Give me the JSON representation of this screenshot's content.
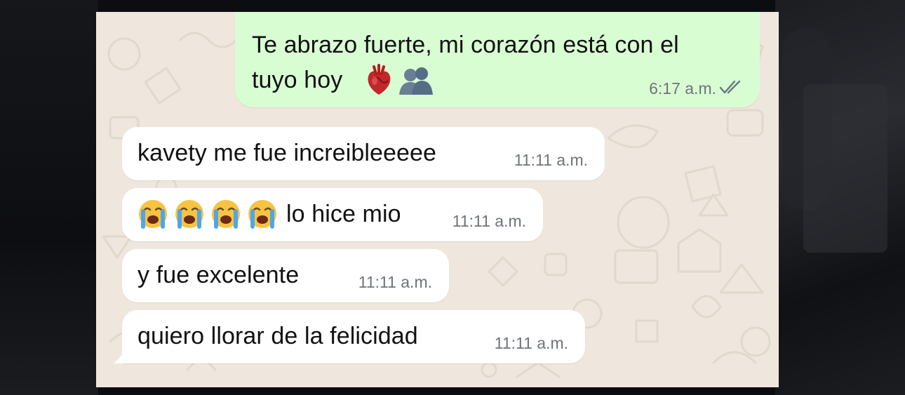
{
  "chat": {
    "colors": {
      "wallpaper": "#efe7dd",
      "outgoing_bubble": "#d9fdd3",
      "incoming_bubble": "#ffffff",
      "timestamp": "#6f7479"
    },
    "outgoing": {
      "line1": "Te abrazo fuerte, mi corazón está con el",
      "line2": "tuyo hoy",
      "emojis": [
        "anatomical-heart-icon",
        "people-silhouette-icon"
      ],
      "time": "6:17 a.m.",
      "status": "read-double-check-icon"
    },
    "incoming": [
      {
        "text": "kavety me fue increibleeeee",
        "time": "11:11 a.m."
      },
      {
        "text": "lo hice mio",
        "emojis": [
          "loudly-crying-face-icon",
          "loudly-crying-face-icon",
          "loudly-crying-face-icon",
          "loudly-crying-face-icon"
        ],
        "time": "11:11 a.m."
      },
      {
        "text": "y fue excelente",
        "time": "11:11 a.m."
      },
      {
        "text": "quiero llorar de la felicidad",
        "time": "11:11 a.m."
      }
    ]
  }
}
